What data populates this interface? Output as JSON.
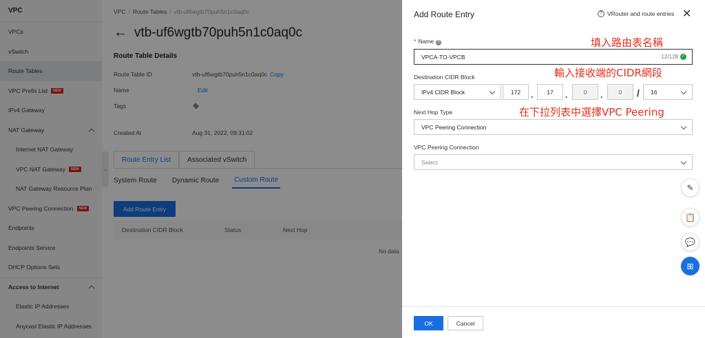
{
  "sidebar": {
    "title": "VPC",
    "items": [
      {
        "label": "VPCs"
      },
      {
        "label": "vSwitch"
      },
      {
        "label": "Route Tables"
      },
      {
        "label": "VPC Prefix List",
        "badge": "NEW"
      },
      {
        "label": "IPv4 Gateway"
      },
      {
        "label": "NAT Gateway"
      },
      {
        "label": "Internet NAT Gateway"
      },
      {
        "label": "VPC NAT Gateway",
        "badge": "NEW"
      },
      {
        "label": "NAT Gateway Resource Plan"
      },
      {
        "label": "VPC Peering Connection",
        "badge": "NEW"
      },
      {
        "label": "Endpoints"
      },
      {
        "label": "Endpoints Service"
      },
      {
        "label": "DHCP Options Sets"
      },
      {
        "label": "Access to Internet"
      },
      {
        "label": "Elastic IP Addresses"
      },
      {
        "label": "Anycast Elastic IP Addresses"
      }
    ]
  },
  "main": {
    "breadcrumb": [
      "VPC",
      "Route Tables",
      "vtb-uf6wgtb70puh5n1c0aq0c"
    ],
    "page_title": "vtb-uf6wgtb70puh5n1c0aq0c",
    "details_title": "Route Table Details",
    "details": {
      "route_table_id_label": "Route Table ID",
      "route_table_id_value": "vtb-uf6wgtb70puh5n1c0aq0c",
      "copy_label": "Copy",
      "name_label": "Name",
      "edit_label": "Edit",
      "tags_label": "Tags",
      "created_label": "Created At",
      "created_value": "Aug 31, 2022, 09:31:02"
    },
    "tabs": [
      {
        "label": "Route Entry List"
      },
      {
        "label": "Associated vSwitch"
      }
    ],
    "subtabs": [
      {
        "label": "System Route"
      },
      {
        "label": "Dynamic Route"
      },
      {
        "label": "Custom Route"
      }
    ],
    "add_button": "Add Route Entry",
    "table_columns": [
      "Destination CIDR Block",
      "Status",
      "Next Hop"
    ],
    "no_data": "No data"
  },
  "drawer": {
    "title": "Add Route Entry",
    "help_link": "VRouter and route entries",
    "name_label": "Name",
    "name_value": "VPCA-TO-VPCB",
    "name_counter": "12/128",
    "cidr_label": "Destination CIDR Block",
    "cidr_type": "IPv4 CIDR Block",
    "cidr_octets": [
      "172",
      "17",
      "0",
      "0"
    ],
    "cidr_mask": "16",
    "next_hop_label": "Next Hop Type",
    "next_hop_value": "VPC Peering Connection",
    "peering_label": "VPC Peering Connection",
    "peering_placeholder": "Select",
    "ok_label": "OK",
    "cancel_label": "Cancel",
    "annotations": {
      "name": "填入路由表名稱",
      "cidr": "輸入接收端的CIDR網段",
      "next_hop": "在下拉列表中選擇VPC Peering"
    }
  },
  "colors": {
    "primary": "#1a6fe0",
    "annotation": "#e0301e",
    "badge": "#e02020",
    "valid": "#1e9e40"
  }
}
